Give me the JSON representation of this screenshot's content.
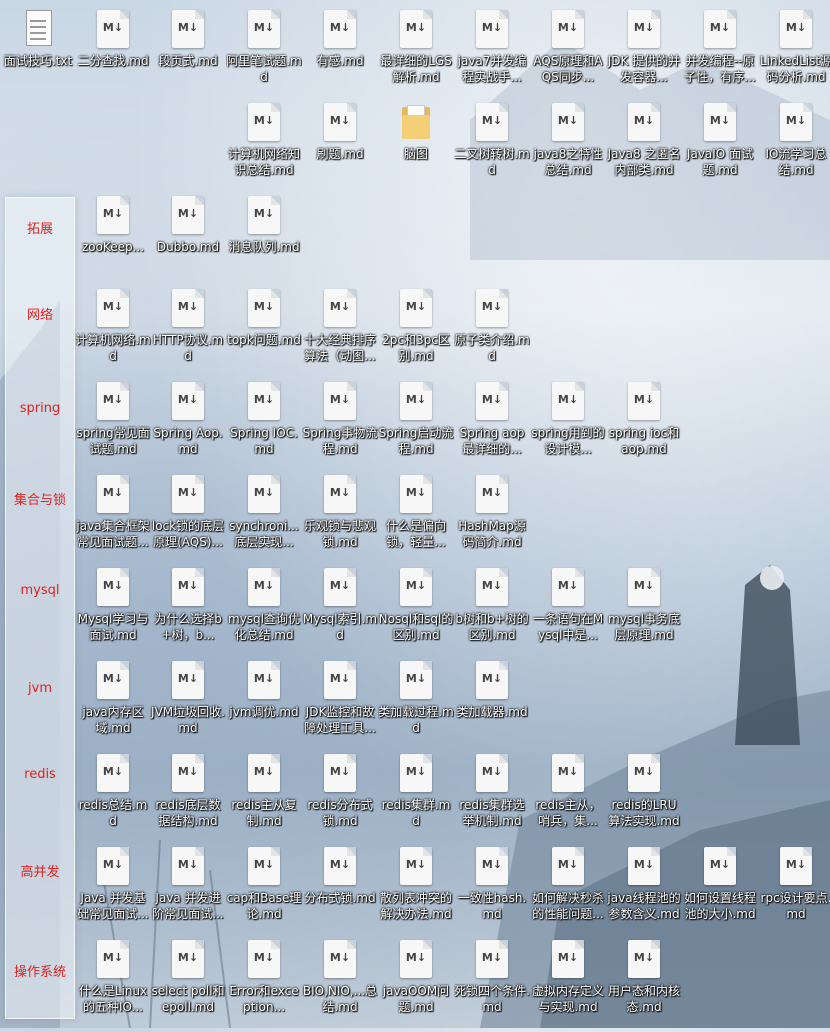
{
  "sidebar": {
    "categories": [
      "拓展",
      "网络",
      "spring",
      "集合与锁",
      "mysql",
      "jvm",
      "redis",
      "高并发",
      "操作系统"
    ]
  },
  "icons": [
    {
      "type": "txt",
      "label": "面试技巧.txt"
    },
    {
      "type": "md",
      "label": "二分查找.md"
    },
    {
      "type": "md",
      "label": "段页式.md"
    },
    {
      "type": "md",
      "label": "阿里笔试题.md"
    },
    {
      "type": "md",
      "label": "有感.md"
    },
    {
      "type": "md",
      "label": "最详细的LGS解析.md"
    },
    {
      "type": "md",
      "label": "java7并发编程实战手..."
    },
    {
      "type": "md",
      "label": "AQS原理和AQS同步..."
    },
    {
      "type": "md",
      "label": "JDK 提供的并发容器..."
    },
    {
      "type": "md",
      "label": "并发编程--原子性，有序..."
    },
    {
      "type": "md",
      "label": "LinkedList源码分析.md"
    },
    {
      "type": "md",
      "label": "计算机网络知识总结.md"
    },
    {
      "type": "md",
      "label": "刷题.md"
    },
    {
      "type": "folder",
      "label": "脑图"
    },
    {
      "type": "md",
      "label": "二叉树转树.md"
    },
    {
      "type": "md",
      "label": "java8之特性总结.md"
    },
    {
      "type": "md",
      "label": "Java8 之匿名内部类.md"
    },
    {
      "type": "md",
      "label": "JavaIO 面试题.md"
    },
    {
      "type": "md",
      "label": "IO流学习总结.md"
    },
    {
      "type": "md",
      "label": "zooKeep..."
    },
    {
      "type": "md",
      "label": "Dubbo.md"
    },
    {
      "type": "md",
      "label": "消息队列.md"
    },
    {
      "type": "md",
      "label": "计算机网络.md"
    },
    {
      "type": "md",
      "label": "HTTP协议.md"
    },
    {
      "type": "md",
      "label": "topk问题.md"
    },
    {
      "type": "md",
      "label": "十大经典排序算法（动图..."
    },
    {
      "type": "md",
      "label": "2pc和3pc区别.md"
    },
    {
      "type": "md",
      "label": "原子类介绍.md"
    },
    {
      "type": "md",
      "label": "spring常见面试题.md"
    },
    {
      "type": "md",
      "label": "Spring Aop.md"
    },
    {
      "type": "md",
      "label": "Spring IOC.md"
    },
    {
      "type": "md",
      "label": "Spring事物流程.md"
    },
    {
      "type": "md",
      "label": "Spring启动流程.md"
    },
    {
      "type": "md",
      "label": "Spring aop最详细的..."
    },
    {
      "type": "md",
      "label": "spring用到的设计模..."
    },
    {
      "type": "md",
      "label": "spring ioc和aop.md"
    },
    {
      "type": "md",
      "label": "java集合框架常见面试题..."
    },
    {
      "type": "md",
      "label": "lock锁的底层原理(AQS)..."
    },
    {
      "type": "md",
      "label": "synchroni...底层实现..."
    },
    {
      "type": "md",
      "label": "乐观锁与悲观锁.md"
    },
    {
      "type": "md",
      "label": "什么是偏向锁，轻量..."
    },
    {
      "type": "md",
      "label": "HashMap源码简介.md"
    },
    {
      "type": "md",
      "label": "Mysql学习与面试.md"
    },
    {
      "type": "md",
      "label": "为什么选择b+树，b..."
    },
    {
      "type": "md",
      "label": "mysql查询优化总结.md"
    },
    {
      "type": "md",
      "label": "Mysql索引.md"
    },
    {
      "type": "md",
      "label": "Nosql和sql的区别.md"
    },
    {
      "type": "md",
      "label": "b树和b+树的区别.md"
    },
    {
      "type": "md",
      "label": "一条语句在Mysql中是..."
    },
    {
      "type": "md",
      "label": "mysql事务底层原理.md"
    },
    {
      "type": "md",
      "label": "java内存区域.md"
    },
    {
      "type": "md",
      "label": "JVM垃圾回收.md"
    },
    {
      "type": "md",
      "label": "jvm调优.md"
    },
    {
      "type": "md",
      "label": "JDK监控和故障处理工具..."
    },
    {
      "type": "md",
      "label": "类加载过程.md"
    },
    {
      "type": "md",
      "label": "类加载器.md"
    },
    {
      "type": "md",
      "label": "redis总结.md"
    },
    {
      "type": "md",
      "label": "redis底层数据结构.md"
    },
    {
      "type": "md",
      "label": "redis主从复制.md"
    },
    {
      "type": "md",
      "label": "redis分布式锁.md"
    },
    {
      "type": "md",
      "label": "redis集群.md"
    },
    {
      "type": "md",
      "label": "redis集群选举机制.md"
    },
    {
      "type": "md",
      "label": "redis主从，哨兵，集..."
    },
    {
      "type": "md",
      "label": "redis的LRU算法实现.md"
    },
    {
      "type": "md",
      "label": "Java 并发基础常见面试..."
    },
    {
      "type": "md",
      "label": "Java 并发进阶常见面试..."
    },
    {
      "type": "md",
      "label": "cap和Base理论.md"
    },
    {
      "type": "md",
      "label": "分布式锁.md"
    },
    {
      "type": "md",
      "label": "散列表冲突的解决办法.md"
    },
    {
      "type": "md",
      "label": "一致性hash.md"
    },
    {
      "type": "md",
      "label": "如何解决秒杀的性能问题..."
    },
    {
      "type": "md",
      "label": "java线程池的参数含义.md"
    },
    {
      "type": "md",
      "label": "如何设置线程池的大小.md"
    },
    {
      "type": "md",
      "label": "rpc设计要点.md"
    },
    {
      "type": "md",
      "label": "什么是Linux的五种IO..."
    },
    {
      "type": "md",
      "label": "select poll和epoll.md"
    },
    {
      "type": "md",
      "label": "Error和exception..."
    },
    {
      "type": "md",
      "label": "BIO,NIO,...总结.md"
    },
    {
      "type": "md",
      "label": "javaOOM问题.md"
    },
    {
      "type": "md",
      "label": "死锁四个条件.md"
    },
    {
      "type": "md",
      "label": "虚拟内存定义与实现.md"
    },
    {
      "type": "md",
      "label": "用户态和内核态.md"
    }
  ]
}
